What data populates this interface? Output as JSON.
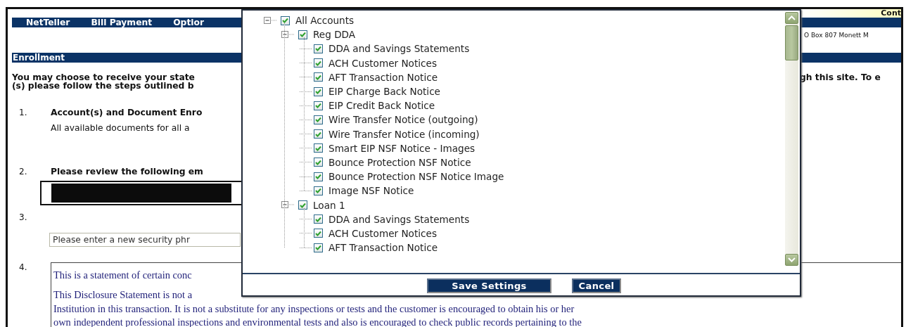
{
  "banner": {
    "label": "Cont"
  },
  "nav": {
    "items": [
      "NetTeller",
      "Bill Payment",
      "Optior"
    ]
  },
  "address": "O Box 807 Monett M",
  "section_title": "Enrollment",
  "intro": {
    "left_lines": [
      "You may choose to receive your state",
      "(s) please follow the steps outlined b"
    ],
    "right_lines": [
      "gh this site. To e"
    ]
  },
  "steps": [
    {
      "kind": "heading",
      "number": "1.",
      "title": "Account(s) and Document Enro",
      "note": "All available documents for all a"
    },
    {
      "kind": "heading",
      "number": "2.",
      "title": "Please review the following em",
      "redacted": true
    },
    {
      "kind": "field",
      "number": "3.",
      "placeholder": "Please enter a new security phr"
    },
    {
      "kind": "disclosure",
      "number": "4.",
      "paragraphs": [
        [
          "This is a statement of certain conc"
        ],
        [
          "This Disclosure Statement is not a",
          "Institution in this transaction. It is not a substitute for any inspections or tests and the customer is encouraged to obtain his or her",
          "own independent professional inspections and environmental tests and also is encouraged to check public records pertaining to the"
        ]
      ]
    }
  ],
  "dialog": {
    "tree": [
      {
        "label": "All Accounts",
        "checked": true,
        "expanded": true,
        "children": [
          {
            "label": "Reg DDA",
            "checked": true,
            "expanded": true,
            "children": [
              {
                "label": "DDA and Savings Statements",
                "checked": true
              },
              {
                "label": "ACH Customer Notices",
                "checked": true
              },
              {
                "label": "AFT Transaction Notice",
                "checked": true
              },
              {
                "label": "EIP Charge Back Notice",
                "checked": true
              },
              {
                "label": "EIP Credit Back Notice",
                "checked": true
              },
              {
                "label": "Wire Transfer Notice (outgoing)",
                "checked": true
              },
              {
                "label": "Wire Transfer Notice (incoming)",
                "checked": true
              },
              {
                "label": "Smart EIP NSF Notice - Images",
                "checked": true
              },
              {
                "label": "Bounce Protection NSF Notice",
                "checked": true
              },
              {
                "label": "Bounce Protection NSF Notice Image",
                "checked": true
              },
              {
                "label": "Image NSF Notice",
                "checked": true
              }
            ]
          },
          {
            "label": "Loan 1",
            "checked": true,
            "expanded": true,
            "children": [
              {
                "label": "DDA and Savings Statements",
                "checked": true
              },
              {
                "label": "ACH Customer Notices",
                "checked": true
              },
              {
                "label": "AFT Transaction Notice",
                "checked": true
              }
            ]
          }
        ]
      }
    ],
    "buttons": [
      "Save Settings",
      "Cancel"
    ]
  }
}
